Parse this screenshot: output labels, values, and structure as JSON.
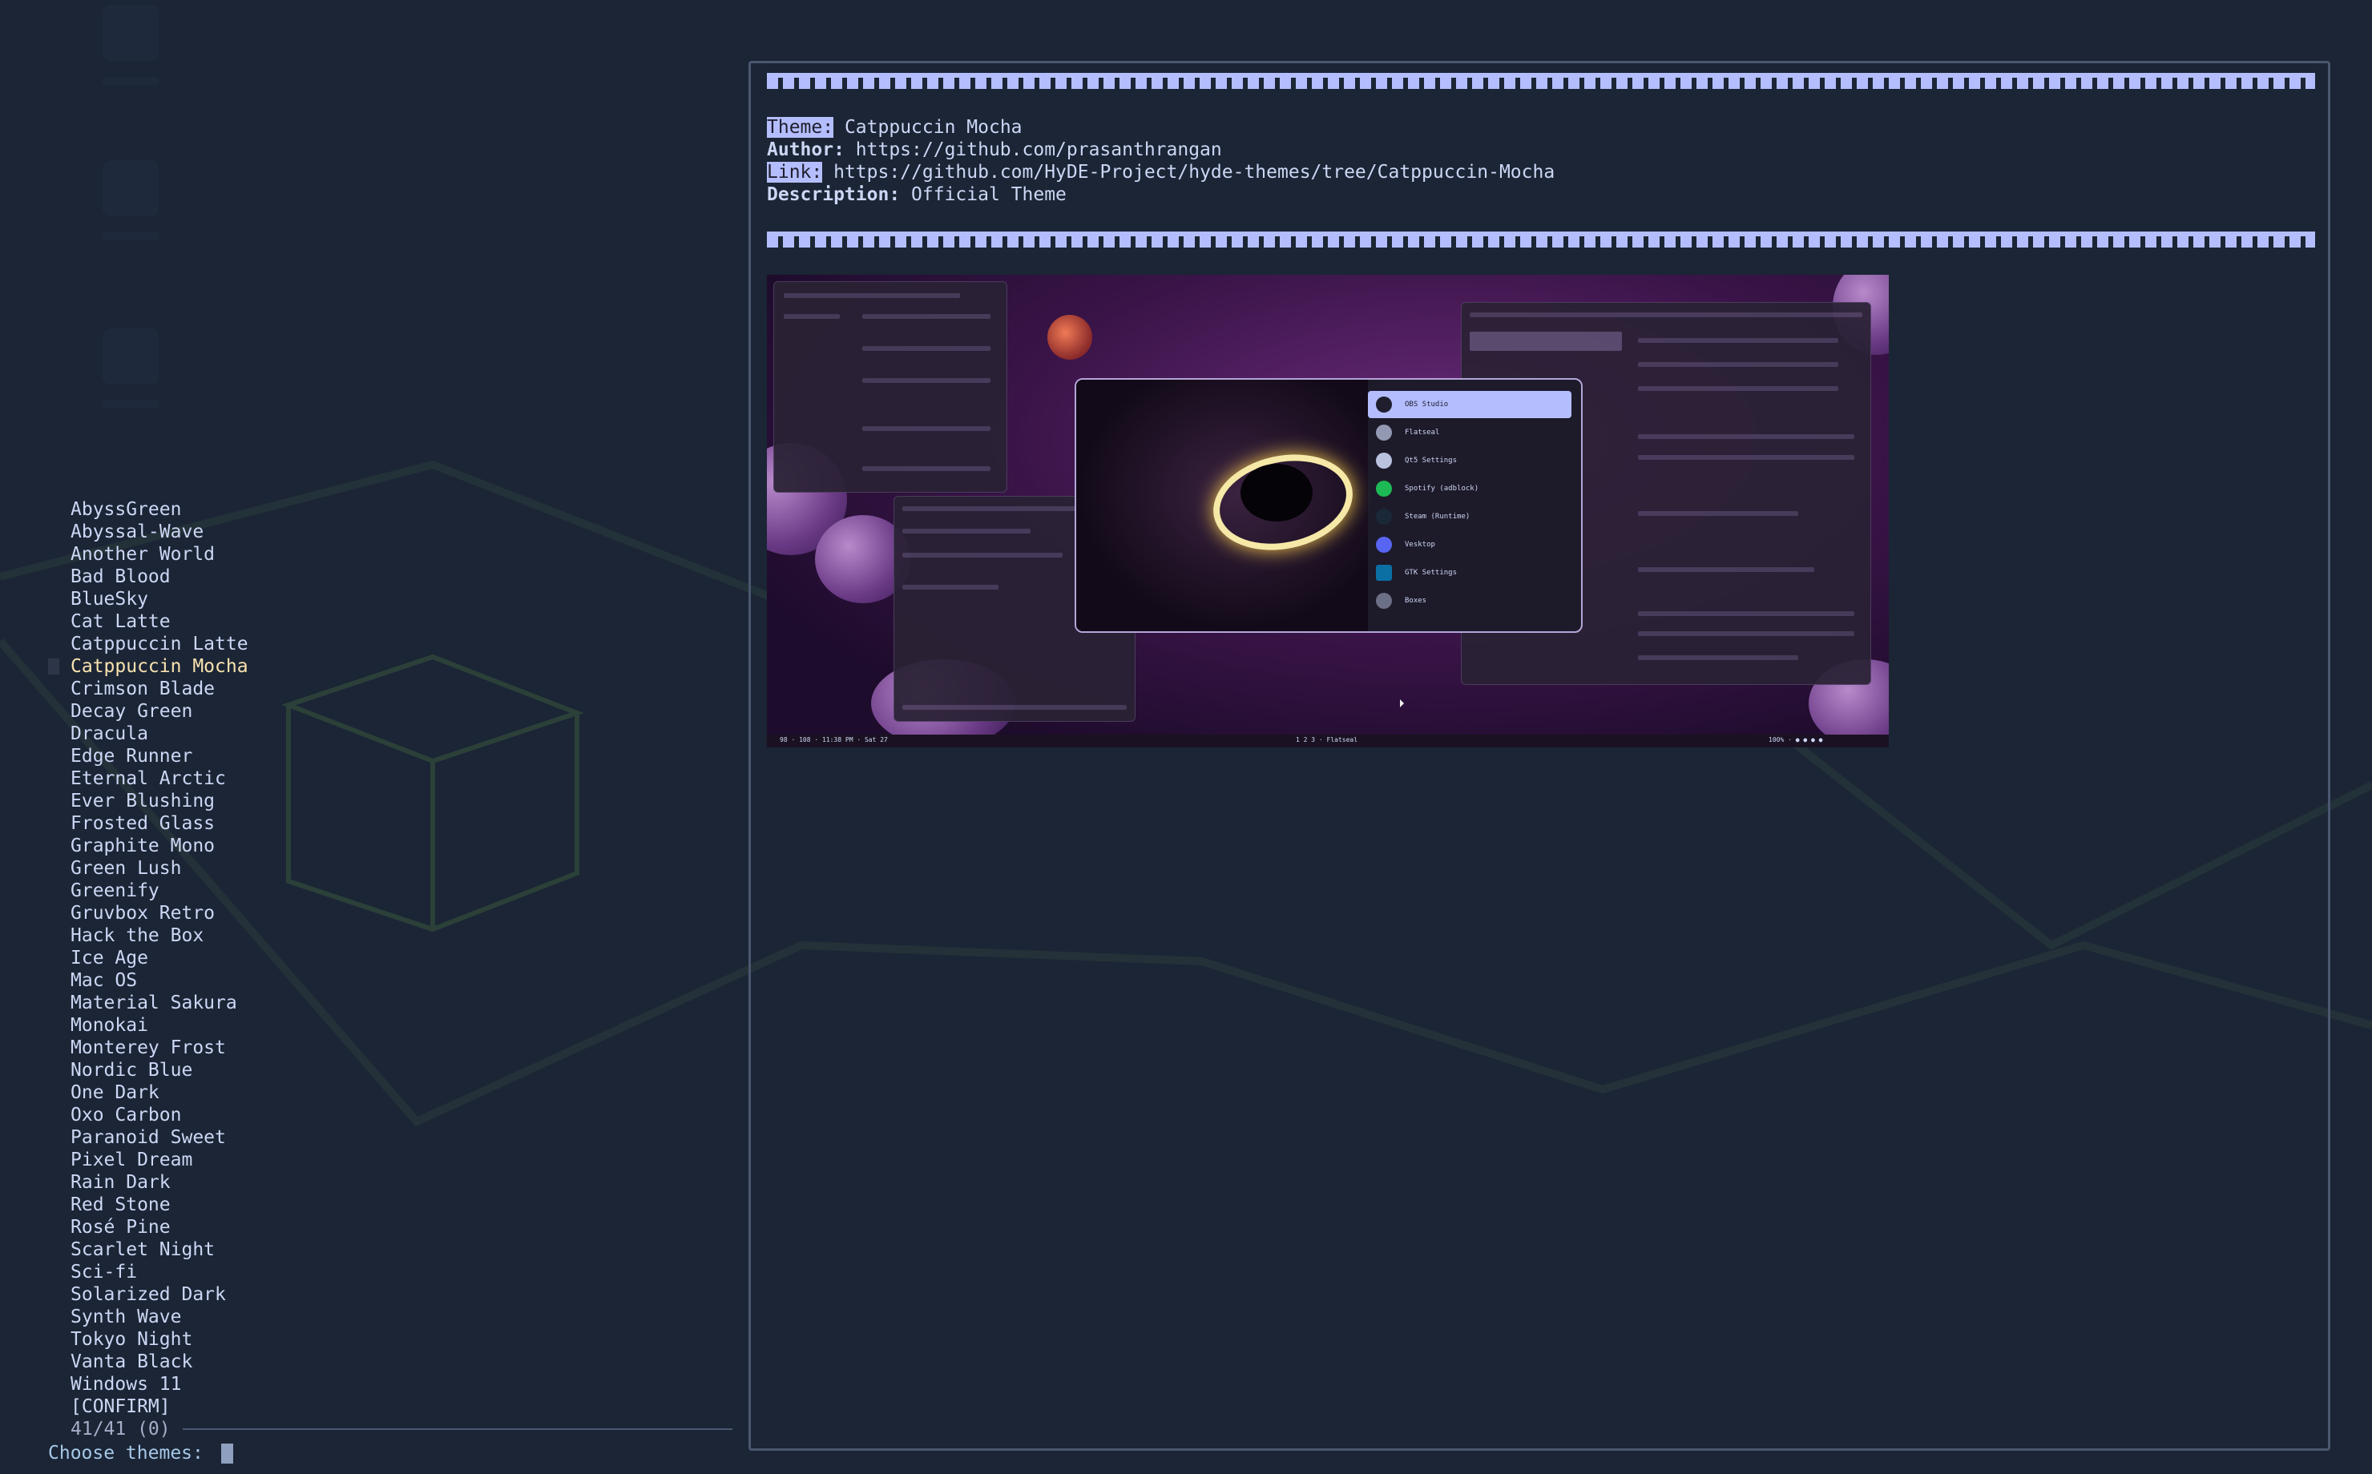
{
  "menu": {
    "items": [
      "AbyssGreen",
      "Abyssal-Wave",
      "Another World",
      "Bad Blood",
      "BlueSky",
      "Cat Latte",
      "Catppuccin Latte",
      "Catppuccin Mocha",
      "Crimson Blade",
      "Decay Green",
      "Dracula",
      "Edge Runner",
      "Eternal Arctic",
      "Ever Blushing",
      "Frosted Glass",
      "Graphite Mono",
      "Green Lush",
      "Greenify",
      "Gruvbox Retro",
      "Hack the Box",
      "Ice Age",
      "Mac OS",
      "Material Sakura",
      "Monokai",
      "Monterey Frost",
      "Nordic Blue",
      "One Dark",
      "Oxo Carbon",
      "Paranoid Sweet",
      "Pixel Dream",
      "Rain Dark",
      "Red Stone",
      "Rosé Pine",
      "Scarlet Night",
      "Sci-fi",
      "Solarized Dark",
      "Synth Wave",
      "Tokyo Night",
      "Vanta Black",
      "Windows 11",
      "[CONFIRM]"
    ],
    "selected": "Catppuccin Mocha",
    "counter": "41/41 (0)",
    "prompt": "Choose themes:",
    "input_value": ""
  },
  "preview": {
    "theme_key": "Theme:",
    "theme_value": "Catppuccin Mocha",
    "author_key": "Author:",
    "author_value": "https://github.com/prasanthrangan",
    "link_key": "Link:",
    "link_value": "https://github.com/HyDE-Project/hyde-themes/tree/Catppuccin-Mocha",
    "description_key": "Description:",
    "description_value": "Official Theme",
    "screenshot": {
      "launcher_items": [
        {
          "label": "OBS Studio",
          "icon": "obs-icon",
          "active": true
        },
        {
          "label": "Flatseal",
          "icon": "flatseal-icon"
        },
        {
          "label": "Qt5 Settings",
          "icon": "qt5-settings-icon"
        },
        {
          "label": "Spotify (adblock)",
          "icon": "spotify-icon"
        },
        {
          "label": "Steam (Runtime)",
          "icon": "steam-icon"
        },
        {
          "label": "Vesktop",
          "icon": "discord-icon"
        },
        {
          "label": "GTK Settings",
          "icon": "gtk-settings-icon"
        },
        {
          "label": "Boxes",
          "icon": "boxes-icon"
        }
      ],
      "taskbar_left": "98 · 108 · 11:38 PM · Sat 27",
      "taskbar_center": "1 2 3 · Flatseal",
      "taskbar_right": "100% · ● ● ● ●"
    }
  },
  "colors": {
    "background": "#1b2535",
    "accent": "#b4befe",
    "selected_text": "#f9e2af",
    "text": "#cdd6f4",
    "border": "#4b5670"
  }
}
